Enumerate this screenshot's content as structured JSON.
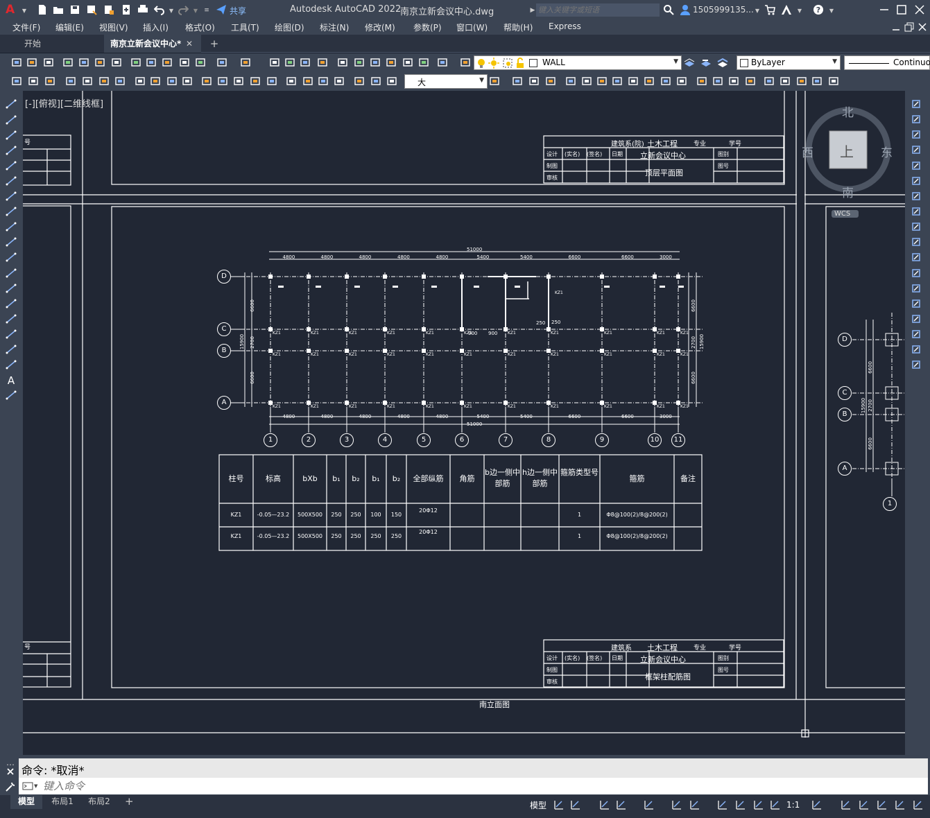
{
  "app": {
    "title": "Autodesk AutoCAD 2022",
    "filename": "南京立新会议中心.dwg",
    "share": "共享",
    "search_placeholder": "键入关键字或短语",
    "user": "1505999135...",
    "logo": "A"
  },
  "menu": [
    "文件(F)",
    "编辑(E)",
    "视图(V)",
    "插入(I)",
    "格式(O)",
    "工具(T)",
    "绘图(D)",
    "标注(N)",
    "修改(M)",
    "参数(P)",
    "窗口(W)",
    "帮助(H)",
    "Express"
  ],
  "tabs": {
    "start": "开始",
    "doc": "南京立新会议中心*",
    "close": "✕",
    "add": "+"
  },
  "toolbar": {
    "layer": "WALL",
    "color": "ByLayer",
    "linetype": "Continuo",
    "textsize": "大"
  },
  "viewport": {
    "label": "[-][俯视][二维线框]",
    "wcs": "WCS",
    "compass": {
      "n": "北",
      "s": "南",
      "e": "东",
      "w": "西",
      "top": "上"
    }
  },
  "titleblock_top": {
    "dept": "建筑系(院)",
    "major": "土木工程",
    "major_suffix": "专业",
    "xuehao": "学号",
    "design": "设计",
    "sign": "(实名)",
    "sign2": "(签名)",
    "date": "日期",
    "project": "立新会议中心",
    "tubie": "图别",
    "draw": "制图",
    "drawing": "顶层平面图",
    "tuhao": "图号",
    "check": "审核"
  },
  "titleblock_bot": {
    "dept": "建筑系",
    "major": "土木工程",
    "major_suffix": "专业",
    "xuehao": "学号",
    "design": "设计",
    "sign": "(实名)",
    "sign2": "(签名)",
    "date": "日期",
    "project": "立新会议中心",
    "tubie": "图别",
    "draw": "制图",
    "drawing": "框架柱配筋图",
    "tuhao": "图号",
    "check": "审核"
  },
  "sidebox_label": "号",
  "plan": {
    "total": "51000",
    "spans_top": [
      "4800",
      "4800",
      "4800",
      "4800",
      "4800",
      "5400",
      "5400",
      "6600",
      "6600",
      "3000"
    ],
    "axes_x": [
      "1",
      "2",
      "3",
      "4",
      "5",
      "6",
      "7",
      "8",
      "9",
      "10",
      "11"
    ],
    "axes_y": [
      "D",
      "C",
      "B",
      "A"
    ],
    "dims_left": [
      "6600",
      "2700",
      "6600",
      "15900"
    ],
    "col": "KZ1",
    "notes": [
      "900",
      "900",
      "250",
      "250"
    ]
  },
  "table": {
    "headers": [
      "柱号",
      "标高",
      "bXb",
      "b₁",
      "b₂",
      "b₁",
      "b₂",
      "全部纵筋",
      "角筋",
      "b边一侧中部筋",
      "h边一侧中部筋",
      "箍筋类型号",
      "箍筋",
      "备注"
    ],
    "rows": [
      [
        "KZ1",
        "-0.05—23.2",
        "500X500",
        "250",
        "250",
        "100",
        "150",
        "20Φ12",
        "",
        "",
        "",
        "1",
        "Φ8@100(2)/8@200(2)",
        ""
      ],
      [
        "KZ1",
        "-0.05—23.2",
        "500X500",
        "250",
        "250",
        "250",
        "250",
        "20Φ12",
        "",
        "",
        "",
        "1",
        "Φ8@100(2)/8@200(2)",
        ""
      ]
    ]
  },
  "elevation_label": "南立面图",
  "right_plan": {
    "axes": [
      "D",
      "C",
      "B",
      "A"
    ],
    "axis_x": "1",
    "dims": [
      "6600",
      "2700",
      "6600",
      "15900"
    ]
  },
  "command": {
    "history": "命令: *取消*",
    "placeholder": "键入命令"
  },
  "layouts": [
    "模型",
    "布局1",
    "布局2"
  ],
  "status": {
    "model": "模型",
    "scale": "1:1"
  }
}
